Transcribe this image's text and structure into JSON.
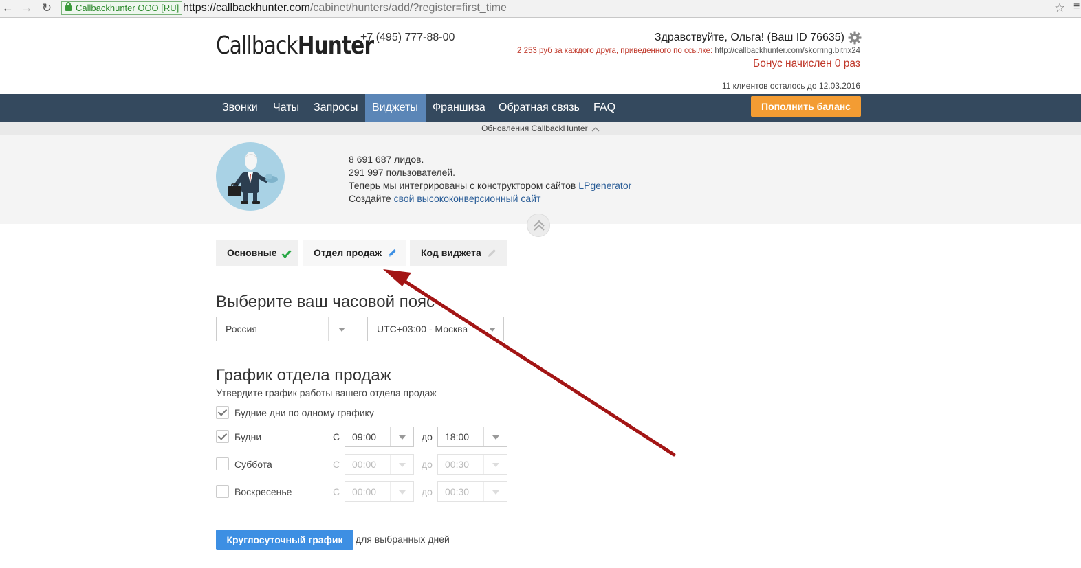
{
  "browser": {
    "ssl_label": "Callbackhunter OOO [RU]",
    "url_host": "https://callbackhunter.com",
    "url_path": "/cabinet/hunters/add/?register=first_time"
  },
  "header": {
    "logo_light": "Callback",
    "logo_bold": "Hunter",
    "phone": "+7 (495) 777-88-00",
    "greeting": "Здравствуйте, Ольга! (Ваш ID 76635)",
    "referral_text": "2 253 руб за каждого друга, приведенного по ссылке: ",
    "referral_link": "http://callbackhunter.com/skorring.bitrix24",
    "bonus": "Бонус начислен 0 раз",
    "clients_left": "11 клиентов осталось до 12.03.2016"
  },
  "nav": {
    "items": [
      "Звонки",
      "Чаты",
      "Запросы",
      "Виджеты",
      "Франшиза",
      "Обратная связь",
      "FAQ"
    ],
    "active": "Виджеты",
    "pay_button": "Пополнить баланс"
  },
  "updates_label": "Обновления CallbackHunter",
  "info": {
    "line1": "8 691 687 лидов.",
    "line2": "291 997 пользователей.",
    "line3_text": "Теперь мы интегрированы с конструктором сайтов ",
    "line3_link": "LPgenerator",
    "line4_text": "Создайте ",
    "line4_link": "свой высококонверсионный сайт"
  },
  "tabs": [
    {
      "label": "Основные",
      "status": "done"
    },
    {
      "label": "Отдел продаж",
      "status": "editing"
    },
    {
      "label": "Код виджета",
      "status": "pending"
    }
  ],
  "timezone": {
    "heading": "Выберите ваш часовой пояс",
    "country": "Россия",
    "zone": "UTC+03:00 - Москва"
  },
  "schedule": {
    "heading": "График отдела продаж",
    "subtitle": "Утвердите график работы вашего отдела продаж",
    "same_schedule_label": "Будние дни по одному графику",
    "same_schedule_checked": true,
    "from_label": "С",
    "to_label": "до",
    "days": [
      {
        "label": "Будни",
        "checked": true,
        "from": "09:00",
        "to": "18:00"
      },
      {
        "label": "Суббота",
        "checked": false,
        "from": "00:00",
        "to": "00:30"
      },
      {
        "label": "Воскресенье",
        "checked": false,
        "from": "00:00",
        "to": "00:30"
      }
    ],
    "round_button": "Круглосуточный график",
    "round_note": "для выбранных дней"
  },
  "colors": {
    "navbar": "#34495e",
    "nav_active": "#5b86b7",
    "pay_button": "#f39c33",
    "primary_button": "#3d8fe3",
    "alert_red": "#c0392b",
    "annotation_arrow": "#a31515"
  }
}
